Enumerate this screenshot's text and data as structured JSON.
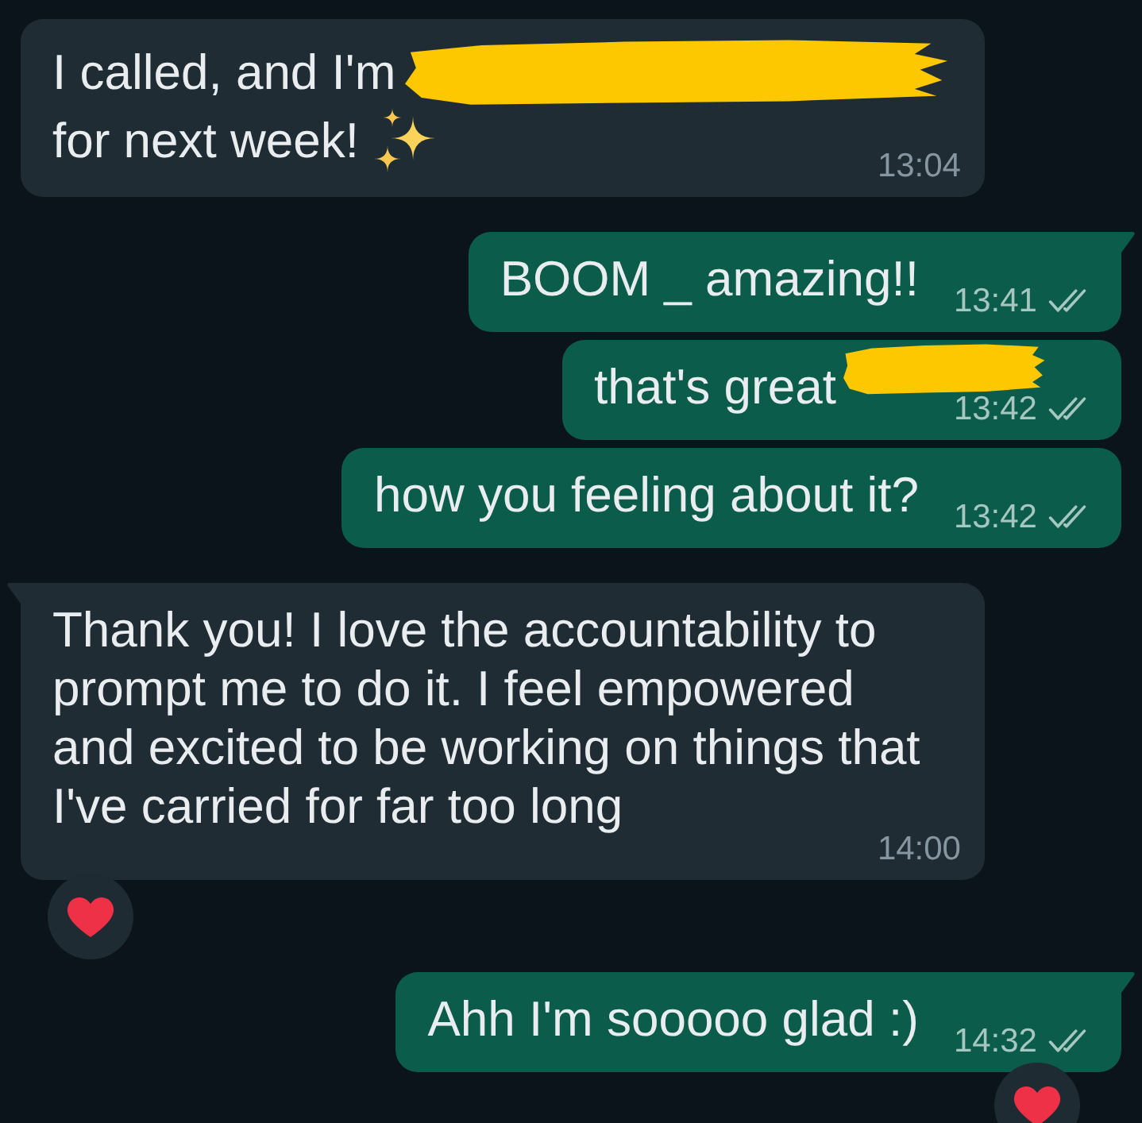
{
  "chat": {
    "messages": [
      {
        "kind": "incoming",
        "tail": false,
        "segments": [
          {
            "kind": "text",
            "text": "I called, and I'm"
          },
          {
            "kind": "redaction"
          },
          {
            "kind": "text",
            "text": "for next week!"
          },
          {
            "kind": "emoji"
          }
        ],
        "time": "13:04",
        "reacted": false
      },
      {
        "kind": "outgoing",
        "tail": true,
        "segments": [
          {
            "kind": "text",
            "text": "BOOM _ amazing!!"
          }
        ],
        "time": "13:41",
        "read": false,
        "reacted": false
      },
      {
        "kind": "outgoing",
        "tail": false,
        "segments": [
          {
            "kind": "text",
            "text": "that's great"
          },
          {
            "kind": "redaction"
          }
        ],
        "time": "13:42",
        "read": false,
        "reacted": false
      },
      {
        "kind": "outgoing",
        "tail": false,
        "segments": [
          {
            "kind": "text",
            "text": "how you feeling about it?"
          }
        ],
        "time": "13:42",
        "read": false,
        "reacted": false
      },
      {
        "kind": "incoming",
        "tail": true,
        "segments": [
          {
            "kind": "text",
            "text": "Thank you! I love the accountability to\nprompt me to do it. I feel empowered\nand excited to be working on things that\nI've carried for far too long"
          }
        ],
        "time": "14:00",
        "reacted": true
      },
      {
        "kind": "outgoing",
        "tail": true,
        "segments": [
          {
            "kind": "text",
            "text": "Ahh I'm sooooo glad :)"
          }
        ],
        "time": "14:32",
        "read": false,
        "reacted": true
      }
    ]
  }
}
